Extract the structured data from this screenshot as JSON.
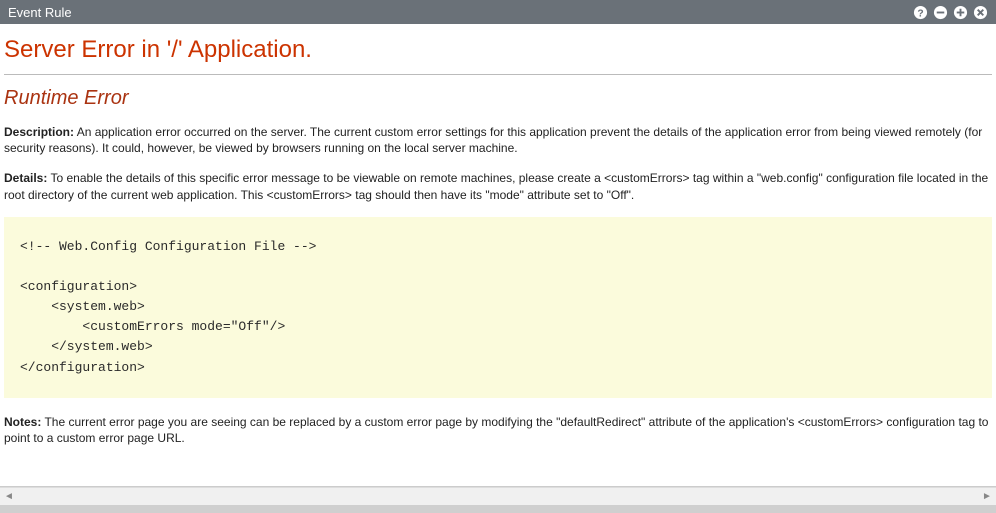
{
  "window": {
    "title": "Event Rule"
  },
  "error": {
    "headline": "Server Error in '/' Application.",
    "subheadline": "Runtime Error",
    "description_label": "Description:",
    "description_text": "An application error occurred on the server. The current custom error settings for this application prevent the details of the application error from being viewed remotely (for security reasons). It could, however, be viewed by browsers running on the local server machine.",
    "details_label": "Details:",
    "details_text": "To enable the details of this specific error message to be viewable on remote machines, please create a <customErrors> tag within a \"web.config\" configuration file located in the root directory of the current web application. This <customErrors> tag should then have its \"mode\" attribute set to \"Off\".",
    "code_block": "<!-- Web.Config Configuration File -->\n\n<configuration>\n    <system.web>\n        <customErrors mode=\"Off\"/>\n    </system.web>\n</configuration>",
    "notes_label": "Notes:",
    "notes_text": "The current error page you are seeing can be replaced by a custom error page by modifying the \"defaultRedirect\" attribute of the application's <customErrors> configuration tag to point to a custom error page URL."
  }
}
